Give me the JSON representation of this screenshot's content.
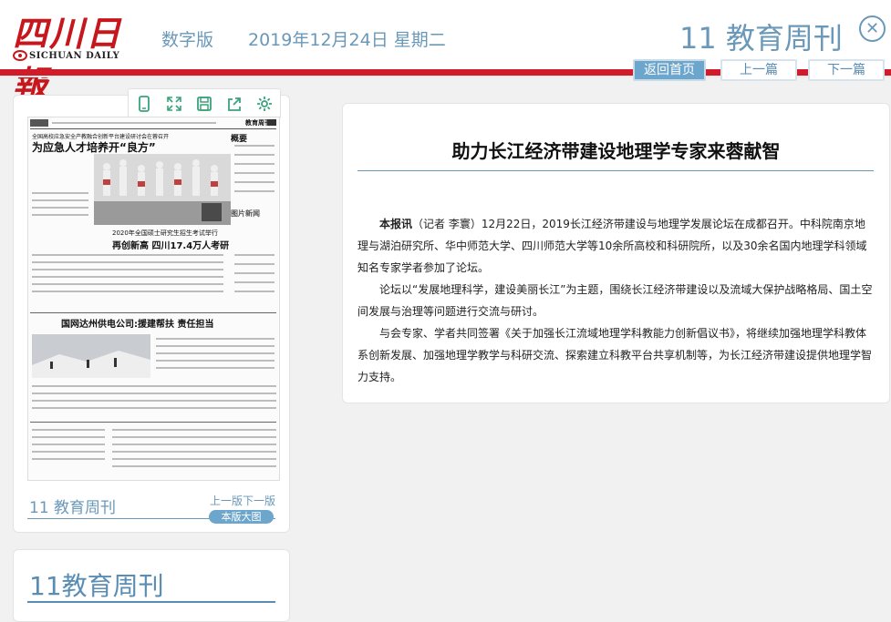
{
  "header": {
    "logo_cn": "四川日報",
    "logo_en": "SICHUAN DAILY",
    "digital_label": "数字版",
    "date": "2019年12月24日 星期二",
    "issue_title": "11 教育周刊",
    "close_icon": "close-circle-icon"
  },
  "nav": {
    "home": "返回首页",
    "prev": "上一篇",
    "next": "下一篇"
  },
  "thumbnail": {
    "tools": [
      "phone-icon",
      "fullscreen-icon",
      "save-icon",
      "share-icon",
      "settings-icon"
    ],
    "newspaper": {
      "masthead_right": "教育周刊",
      "page_no": "11",
      "kicker": "全国高校应急安全产教融合创新平台建设研讨会在蓉召开",
      "headline": "为应急人才培养开“良方”",
      "sidebar_heading": "概要",
      "photo_tag": "图片新闻",
      "exam_kicker": "2020年全国硕士研究生招生考试举行",
      "exam_headline": "再创新高 四川17.4万人考研",
      "dazhou_headline": "国网达州供电公司:援建帮扶 责任担当"
    },
    "edition_label": "11 教育周刊",
    "prev_page": "上一版",
    "next_page": "下一版",
    "full_page_button": "本版大图"
  },
  "list_panel": {
    "title": "11教育周刊"
  },
  "article": {
    "title": "助力长江经济带建设地理学专家来蓉献智",
    "lead": "本报讯",
    "p1": "（记者 李寰）12月22日，2019长江经济带建设与地理学发展论坛在成都召开。中科院南京地理与湖泊研究所、华中师范大学、四川师范大学等10余所高校和科研院所，以及30余名国内地理学科领域知名专家学者参加了论坛。",
    "p2": "论坛以“发展地理科学，建设美丽长江”为主题，围绕长江经济带建设以及流域大保护战略格局、国土空间发展与治理等问题进行交流与研讨。",
    "p3": "与会专家、学者共同签署《关于加强长江流域地理学科教能力创新倡议书》，将继续加强地理学科教体系创新发展、加强地理学教学与科研交流、探索建立科教平台共享机制等，为长江经济带建设提供地理学智力支持。"
  },
  "colors": {
    "accent": "#6a98b8",
    "brand_red": "#d11a2a",
    "button_blue": "#6ca6cc"
  }
}
